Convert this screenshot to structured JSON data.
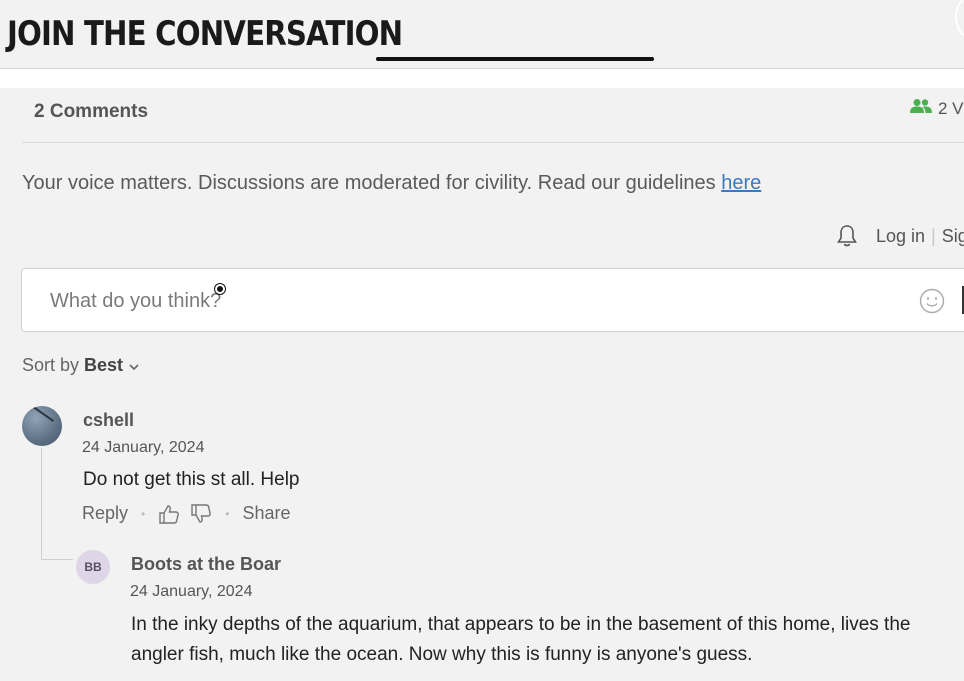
{
  "header": {
    "title": "JOIN THE CONVERSATION"
  },
  "comments_header": {
    "count_label": "2 Comments",
    "viewers_label": "2 V",
    "viewers_icon": "users-icon",
    "accent_color": "#4caf50"
  },
  "guidelines": {
    "text": "Your voice matters. Discussions are moderated for civility. Read our guidelines ",
    "link_label": "here"
  },
  "auth": {
    "login_label": "Log in",
    "separator": "|",
    "signup_label": "Sig"
  },
  "composer": {
    "placeholder": "What do you think?"
  },
  "sort": {
    "prefix": "Sort by",
    "value": "Best"
  },
  "comments": [
    {
      "author": "cshell",
      "date": "24 January, 2024",
      "text": "Do not get this st all. Help",
      "reply_label": "Reply",
      "share_label": "Share"
    },
    {
      "author": "Boots at the Boar",
      "initials": "BB",
      "date": "24 January, 2024",
      "text": "In the inky depths of the aquarium, that appears to be in the basement of this home, lives the angler fish, much like the ocean.  Now why this is funny is anyone's guess."
    }
  ]
}
